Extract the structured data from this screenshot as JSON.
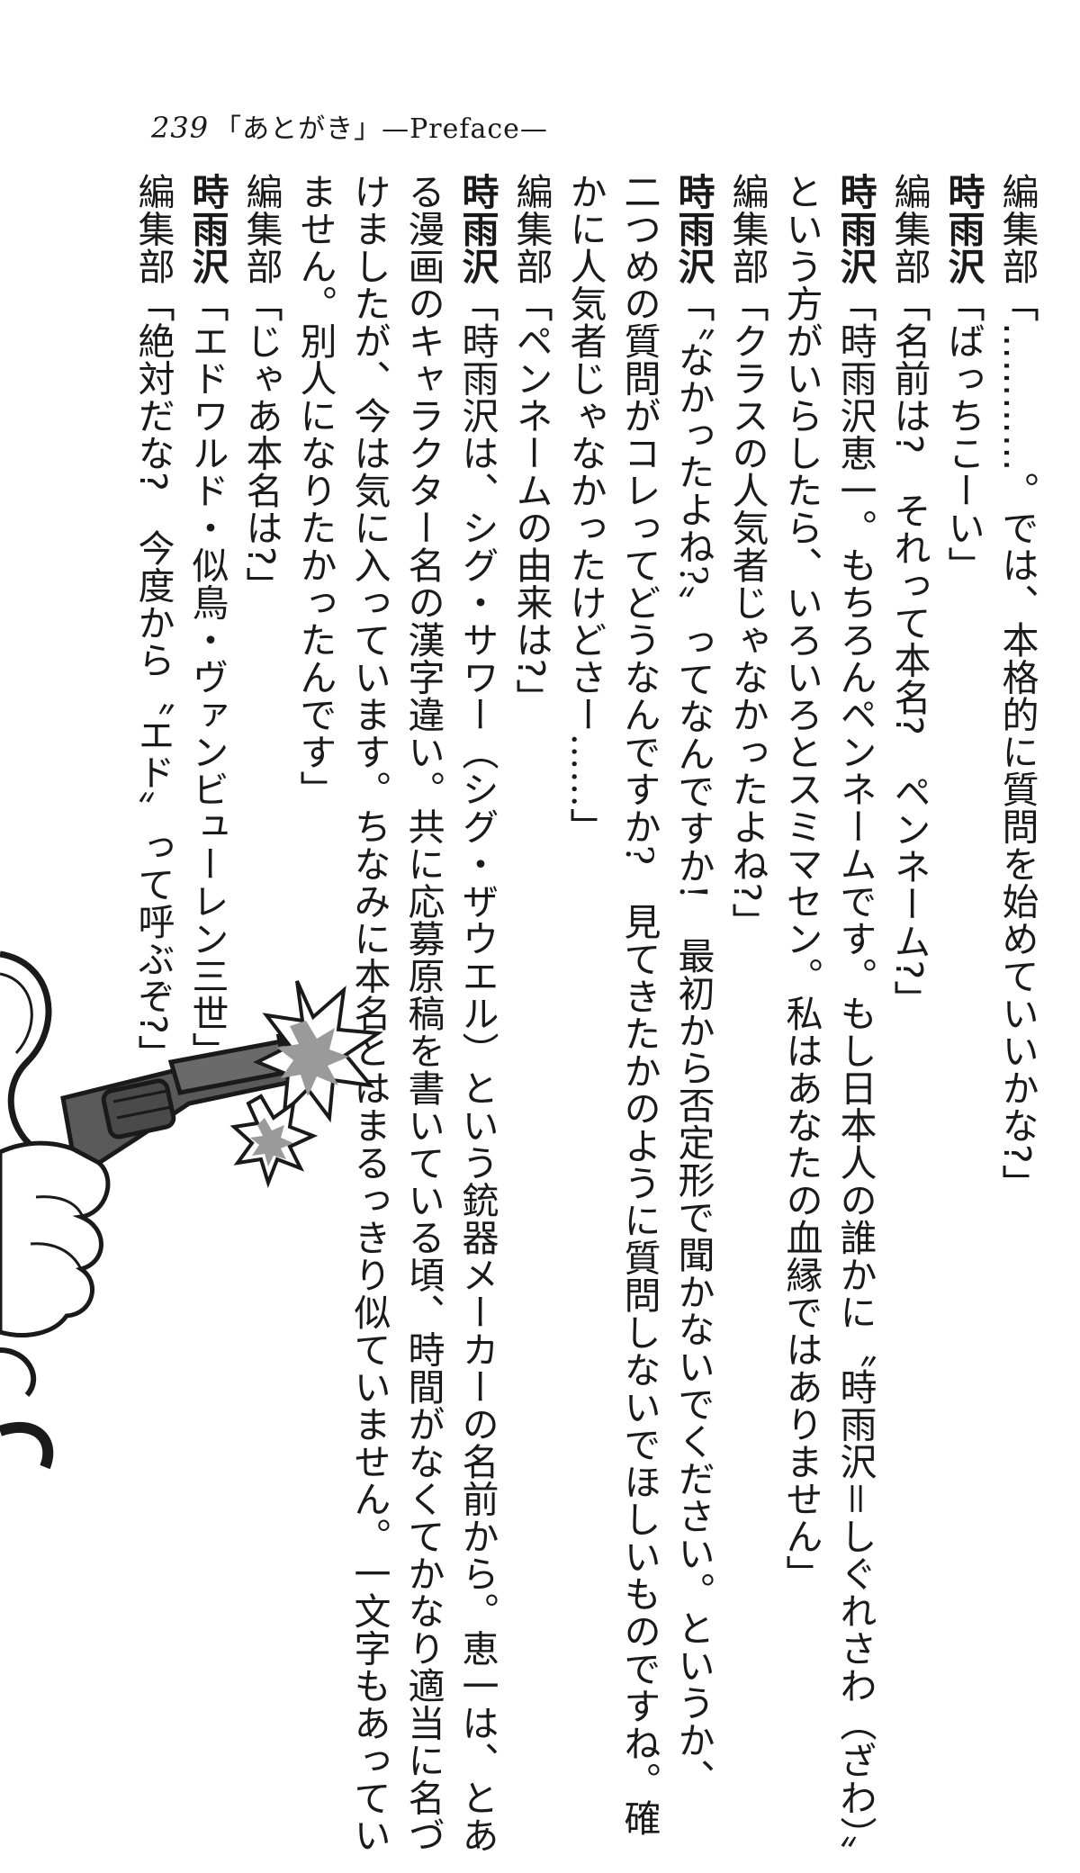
{
  "header": {
    "page_number": "239",
    "title": "「あとがき」—Preface—"
  },
  "dialogue": [
    {
      "speaker": "編集部",
      "lines": [
        "「…………。では、本格的に質問を始めていいかな?」"
      ]
    },
    {
      "speaker": "時雨沢",
      "lines": [
        "「ばっちこーい」"
      ]
    },
    {
      "speaker": "編集部",
      "lines": [
        "「名前は?　それって本名?　ペンネーム?」"
      ]
    },
    {
      "speaker": "時雨沢",
      "lines": [
        "「時雨沢恵一。もちろんペンネームです。もし日本人の誰かに〝時雨沢＝しぐれさわ（ざわ）〟",
        "という方がいらしたら、いろいろとスミマセン。私はあなたの血縁ではありません」"
      ]
    },
    {
      "speaker": "編集部",
      "lines": [
        "「クラスの人気者じゃなかったよね?」"
      ]
    },
    {
      "speaker": "時雨沢",
      "lines": [
        "「〝なかったよね?〟ってなんですか!　最初から否定形で聞かないでください。というか、",
        "二つめの質問がコレってどうなんですか?　見てきたかのように質問しないでほしいものですね。確",
        "かに人気者じゃなかったけどさー……」"
      ]
    },
    {
      "speaker": "編集部",
      "lines": [
        "「ペンネームの由来は?」"
      ]
    },
    {
      "speaker": "時雨沢",
      "lines": [
        "「時雨沢は、シグ・サワー（シグ・ザウエル）という銃器メーカーの名前から。恵一は、とあ",
        "る漫画のキャラクター名の漢字違い。共に応募原稿を書いている頃、時間がなくてかなり適当に名づ",
        "けましたが、今は気に入っています。ちなみに本名とはまるっきり似ていません。一文字もあってい",
        "ません。別人になりたかったんです」"
      ]
    },
    {
      "speaker": "編集部",
      "lines": [
        "「じゃあ本名は?」"
      ]
    },
    {
      "speaker": "時雨沢",
      "lines": [
        "「エドワルド・似鳥・ヴァンビューレン三世」"
      ]
    },
    {
      "speaker": "編集部",
      "lines": [
        "「絶対だな?　今度から〝エド〟って呼ぶぞ?」"
      ]
    }
  ],
  "illustration": {
    "icon": "revolver-firing-icon",
    "colors": {
      "ink": "#1a1a1a",
      "fill": "#5a5a5a",
      "flash": "#9a9a9a"
    }
  }
}
